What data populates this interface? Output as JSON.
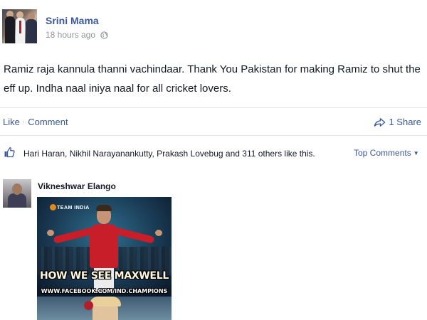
{
  "post": {
    "author": "Srini Mama",
    "timestamp": "18 hours ago",
    "privacy_icon": "globe-icon",
    "text": "Ramiz raja kannula thanni vachindaar. Thank You Pakistan for making Ramiz to shut the eff up. Indha naal iniya naal for all cricket lovers."
  },
  "actions": {
    "like": "Like",
    "separator": "·",
    "comment": "Comment",
    "share": "1 Share"
  },
  "likes": {
    "text": "Hari Haran, Nikhil Narayanankutty, Prakash Lovebug and 311 others like this.",
    "top_comments": "Top Comments"
  },
  "comment": {
    "author": "Vikneshwar Elango",
    "image": {
      "logo_text": "TEAM INDIA",
      "caption": "HOW WE SEE MAXWELL",
      "watermark": "WWW.FACEBOOK.COM/IND.CHAMPIONS"
    }
  },
  "colors": {
    "link": "#3b5998",
    "text": "#141823",
    "muted": "#90949c",
    "divider": "#e5e5e5"
  }
}
